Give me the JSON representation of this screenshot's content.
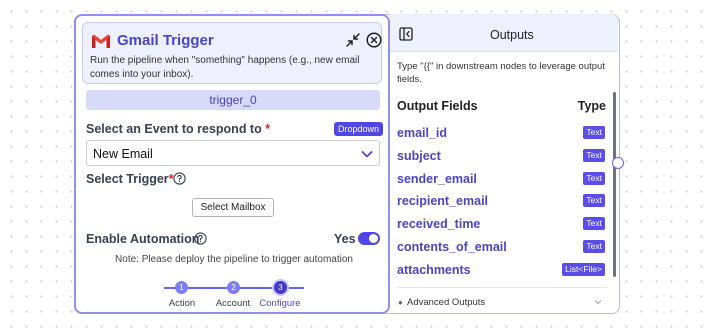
{
  "node": {
    "title": "Gmail Trigger",
    "description": "Run the pipeline when \"something\" happens (e.g., new email comes into your inbox).",
    "id": "trigger_0"
  },
  "event": {
    "label": "Select an Event to respond to",
    "required_mark": "*",
    "badge": "Dropdown",
    "selected": "New Email"
  },
  "trigger": {
    "label": "Select Trigger",
    "required_mark": "*",
    "button": "Select Mailbox"
  },
  "automation": {
    "label": "Enable Automation",
    "value_label": "Yes",
    "enabled": true,
    "note": "Note: Please deploy the pipeline to trigger automation"
  },
  "steps": [
    {
      "number": "1",
      "label": "Action"
    },
    {
      "number": "2",
      "label": "Account"
    },
    {
      "number": "3",
      "label": "Configure"
    }
  ],
  "outputs": {
    "title": "Outputs",
    "hint": "Type \"{{\" in downstream nodes to leverage output fields.",
    "fields_header": "Output Fields",
    "type_header": "Type",
    "fields": [
      {
        "name": "email_id",
        "type": "Text"
      },
      {
        "name": "subject",
        "type": "Text"
      },
      {
        "name": "sender_email",
        "type": "Text"
      },
      {
        "name": "recipient_email",
        "type": "Text"
      },
      {
        "name": "received_time",
        "type": "Text"
      },
      {
        "name": "contents_of_email",
        "type": "Text"
      },
      {
        "name": "attachments",
        "type": "List<File>"
      }
    ],
    "advanced_label": "Advanced Outputs"
  },
  "colors": {
    "accent": "#4f46e5",
    "title": "#4b44c4",
    "required": "#dc2626"
  }
}
